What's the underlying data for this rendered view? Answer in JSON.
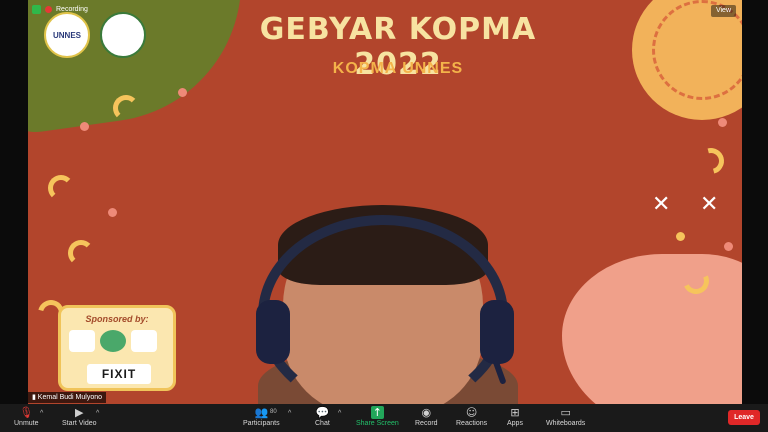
{
  "meeting": {
    "recording_label": "Recording",
    "view_label": "View"
  },
  "slide": {
    "title": "GEBYAR KOPMA 2022",
    "subtitle": "KOPMA UNNES",
    "logo_1_text": "UNNES",
    "sponsor_label": "Sponsored by:",
    "sponsor_main": "FIXIT"
  },
  "participant": {
    "name": "Kemal Budi Mulyono"
  },
  "toolbar": {
    "unmute": "Unmute",
    "start_video": "Start Video",
    "participants": "Participants",
    "participants_count": "80",
    "chat": "Chat",
    "share_screen": "Share Screen",
    "record": "Record",
    "reactions": "Reactions",
    "apps": "Apps",
    "whiteboards": "Whiteboards",
    "leave": "Leave"
  },
  "colors": {
    "background": "#b2452c",
    "accent_yellow": "#f6c45c",
    "share_green": "#22a65a",
    "leave_red": "#e02828"
  },
  "icons": {
    "unmute": "microphone-muted-icon",
    "start_video": "video-camera-muted-icon",
    "participants": "people-icon",
    "chat": "chat-bubble-icon",
    "share_screen": "share-screen-icon",
    "record": "record-icon",
    "reactions": "emoji-icon",
    "apps": "apps-icon",
    "whiteboards": "whiteboard-icon"
  }
}
